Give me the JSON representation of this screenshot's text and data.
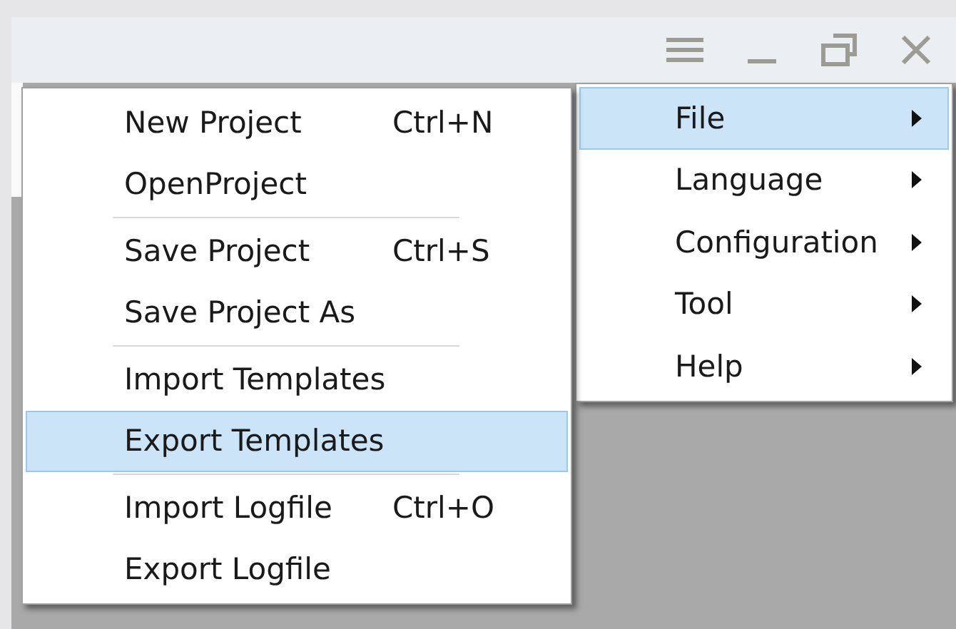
{
  "main_menu": {
    "items": [
      {
        "label": "File",
        "selected": true,
        "has_submenu": true
      },
      {
        "label": "Language",
        "selected": false,
        "has_submenu": true
      },
      {
        "label": "Configuration",
        "selected": false,
        "has_submenu": true
      },
      {
        "label": "Tool",
        "selected": false,
        "has_submenu": true
      },
      {
        "label": "Help",
        "selected": false,
        "has_submenu": true
      }
    ]
  },
  "file_menu": {
    "groups": [
      [
        {
          "label": "New Project",
          "shortcut": "Ctrl+N",
          "selected": false
        },
        {
          "label": "OpenProject",
          "selected": false
        }
      ],
      [
        {
          "label": "Save Project",
          "shortcut": "Ctrl+S",
          "selected": false
        },
        {
          "label": "Save Project As",
          "selected": false
        }
      ],
      [
        {
          "label": "Import Templates",
          "selected": false
        },
        {
          "label": "Export Templates",
          "selected": true
        }
      ],
      [
        {
          "label": "Import Logfile",
          "shortcut": "Ctrl+O",
          "selected": false
        },
        {
          "label": "Export Logfile",
          "selected": false
        }
      ]
    ]
  }
}
